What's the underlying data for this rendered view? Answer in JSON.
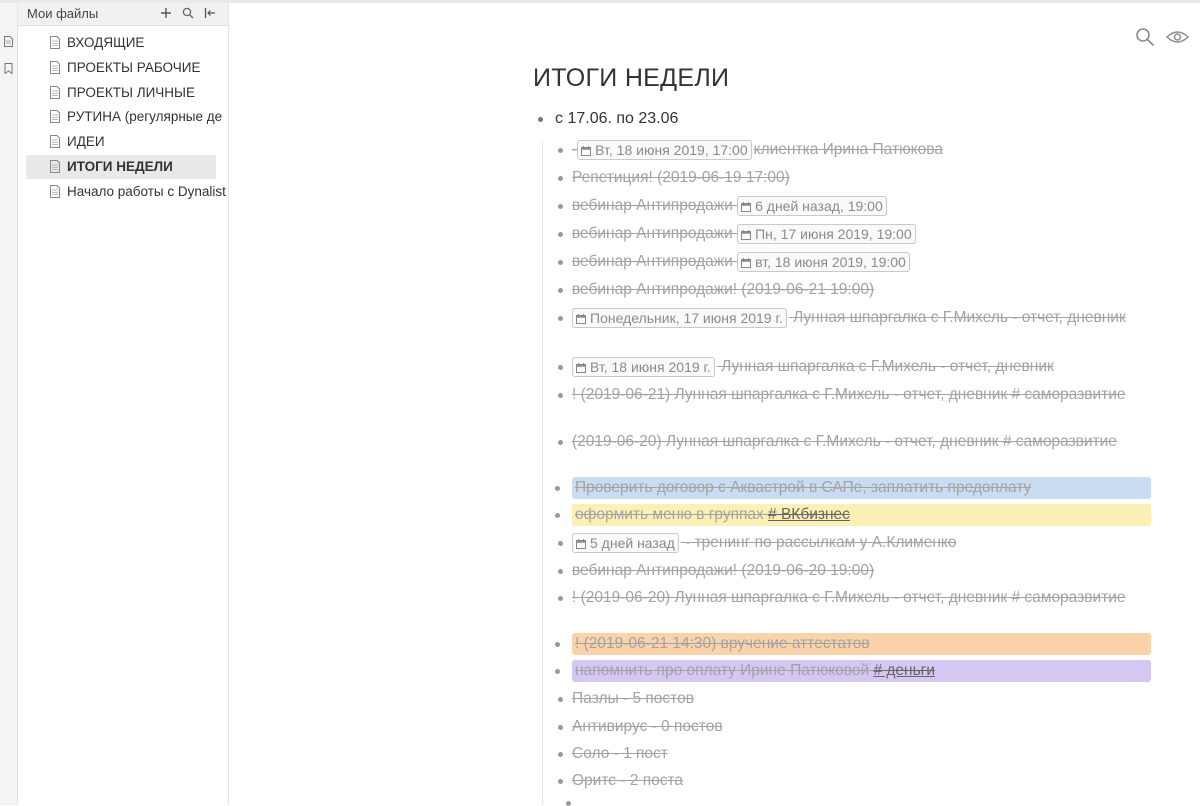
{
  "sidebar": {
    "title": "Мои файлы",
    "add_icon": "plus-icon",
    "search_icon": "search-icon",
    "collapse_icon": "collapse-left-icon",
    "files": [
      {
        "label": "ВХОДЯЩИЕ",
        "active": false
      },
      {
        "label": "ПРОЕКТЫ РАБОЧИЕ",
        "active": false
      },
      {
        "label": "ПРОЕКТЫ ЛИЧНЫЕ",
        "active": false
      },
      {
        "label": "РУТИНА (регулярные де",
        "active": false
      },
      {
        "label": "ИДЕИ",
        "active": false
      },
      {
        "label": "ИТОГИ НЕДЕЛИ",
        "active": true
      },
      {
        "label": "Начало работы с Dynalist",
        "active": false
      }
    ]
  },
  "rail": {
    "icons": [
      "file-icon",
      "bookmark-icon"
    ]
  },
  "toolbar": {
    "icons": [
      "search-icon",
      "eye-icon"
    ]
  },
  "document": {
    "title": "ИТОГИ НЕДЕЛИ",
    "period": "с 17.06. по 23.06",
    "items": [
      {
        "pre": "-",
        "date": "Вт, 18 июня 2019, 17:00",
        "text": "клиентка Ирина Патюкова"
      },
      {
        "text": "Репетиция! (2019-06-19 17:00)"
      },
      {
        "text": "вебинар Антипродажи ",
        "date": "6 дней назад, 19:00"
      },
      {
        "text": "вебинар Антипродажи ",
        "date": "Пн, 17 июня 2019, 19:00"
      },
      {
        "text": "вебинар Антипродажи ",
        "date": "вт, 18 июня 2019, 19:00"
      },
      {
        "text": "вебинар Антипродажи! (2019-06-21 19:00)"
      },
      {
        "date": "Понедельник, 17 июня 2019 г.",
        "text": " Лунная шпаргалка с Г.Михель - отчет, дневник"
      },
      {
        "date": "Вт, 18 июня 2019 г.",
        "text": " Лунная шпаргалка с Г.Михель - отчет, дневник"
      },
      {
        "text": "! (2019-06-21) Лунная шпаргалка с Г.Михель - отчет, дневник # саморазвитие"
      },
      {
        "text": "(2019-06-20) Лунная шпаргалка с Г.Михель - отчет, дневник # саморазвитие"
      },
      {
        "text": "Проверить договор с Аквастрой в САПе, заплатить предоплату",
        "color": "#c9dcf2"
      },
      {
        "text": "оформить меню в группах ",
        "tag": "# ВКбизнес",
        "color": "#fdf0b6"
      },
      {
        "date": "5 дней назад",
        "text": " - тренинг по рассылкам у А.Клименко"
      },
      {
        "text": "вебинар Антипродажи! (2019-06-20 19:00)"
      },
      {
        "text": "! (2019-06-20) Лунная шпаргалка с Г.Михель - отчет, дневник # саморазвитие"
      },
      {
        "text": "! (2019-06-21 14:30) вручение аттестатов",
        "color": "#fbd3aa"
      },
      {
        "text": "напомнить про оплату Ирине Патюковой ",
        "tag": "# деньги",
        "color": "#d5c6f2"
      },
      {
        "text": "Пазлы - 5 постов"
      },
      {
        "text": "Антивирус - 0 постов"
      },
      {
        "text": "Соло - 1 пост"
      },
      {
        "text": "Оритс - 2 поста"
      }
    ]
  }
}
